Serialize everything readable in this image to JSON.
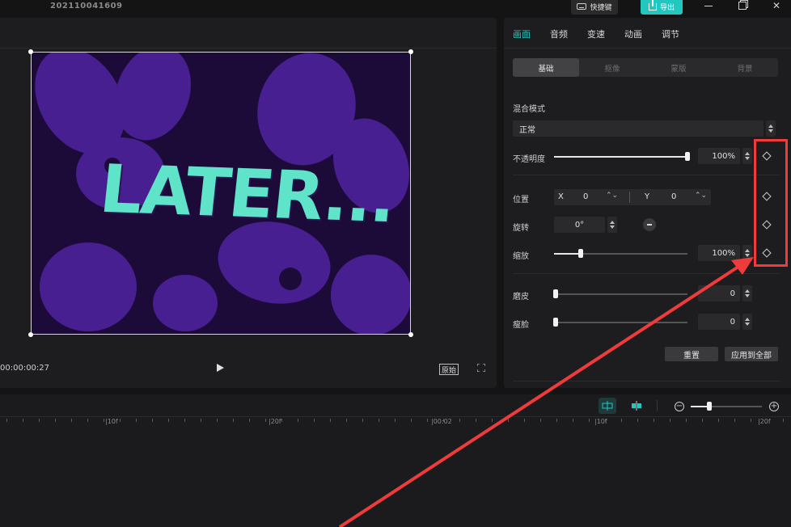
{
  "app": {
    "project_title": "202110041609",
    "shortcut_label": "快捷键",
    "export_label": "导出"
  },
  "preview": {
    "overlay_text": "LATER...",
    "timecode": "00:00:00:27",
    "ratio_label": "原始"
  },
  "panel": {
    "tabs": [
      {
        "label": "画面",
        "active": true
      },
      {
        "label": "音频"
      },
      {
        "label": "变速"
      },
      {
        "label": "动画"
      },
      {
        "label": "调节"
      }
    ],
    "subtabs": [
      {
        "label": "基础",
        "active": true
      },
      {
        "label": "抠像"
      },
      {
        "label": "蒙版"
      },
      {
        "label": "背景"
      }
    ],
    "blend_mode_label": "混合模式",
    "blend_mode_value": "正常",
    "opacity_label": "不透明度",
    "opacity_value": "100%",
    "opacity_fraction": 1.0,
    "position_label": "位置",
    "x_label": "X",
    "x_value": "0",
    "y_label": "Y",
    "y_value": "0",
    "rotation_label": "旋转",
    "rotation_value": "0°",
    "scale_label": "缩放",
    "scale_value": "100%",
    "scale_fraction": 0.2,
    "smooth_label": "磨皮",
    "smooth_value": "0",
    "slim_label": "瘦脸",
    "slim_value": "0",
    "reset_label": "重置",
    "apply_all_label": "应用到全部"
  },
  "timeline": {
    "ruler_labels": [
      "|10f",
      "|20f",
      "|00:02",
      "|10f",
      "|20f"
    ]
  },
  "colors": {
    "accent": "#22c7c0",
    "annotation_red": "#ef3b3b"
  }
}
